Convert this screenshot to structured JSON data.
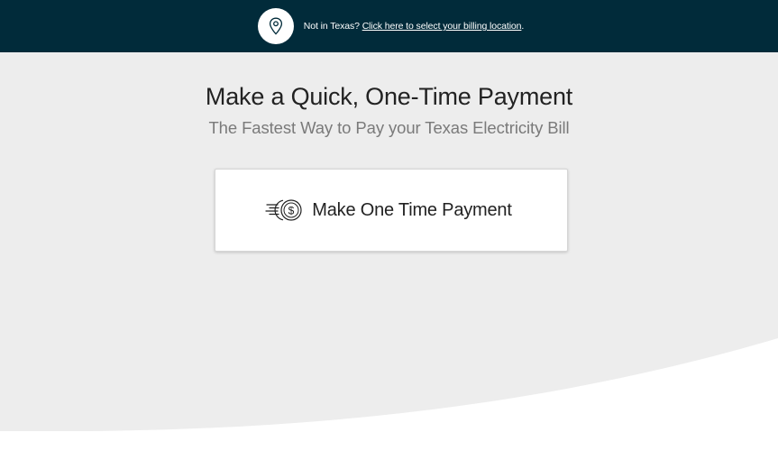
{
  "location_bar": {
    "prefix_text": "Not in Texas? ",
    "link_text": "Click here to select your billing location",
    "suffix_text": ".",
    "icon": "location-pin-icon",
    "background_color": "#012b3a"
  },
  "hero": {
    "title": "Make a Quick, One-Time Payment",
    "subtitle": "The Fastest Way to Pay your Texas Electricity Bill",
    "background_color": "#ededed"
  },
  "payment_button": {
    "label": "Make One Time Payment",
    "icon": "fast-dollar-coin-icon"
  }
}
